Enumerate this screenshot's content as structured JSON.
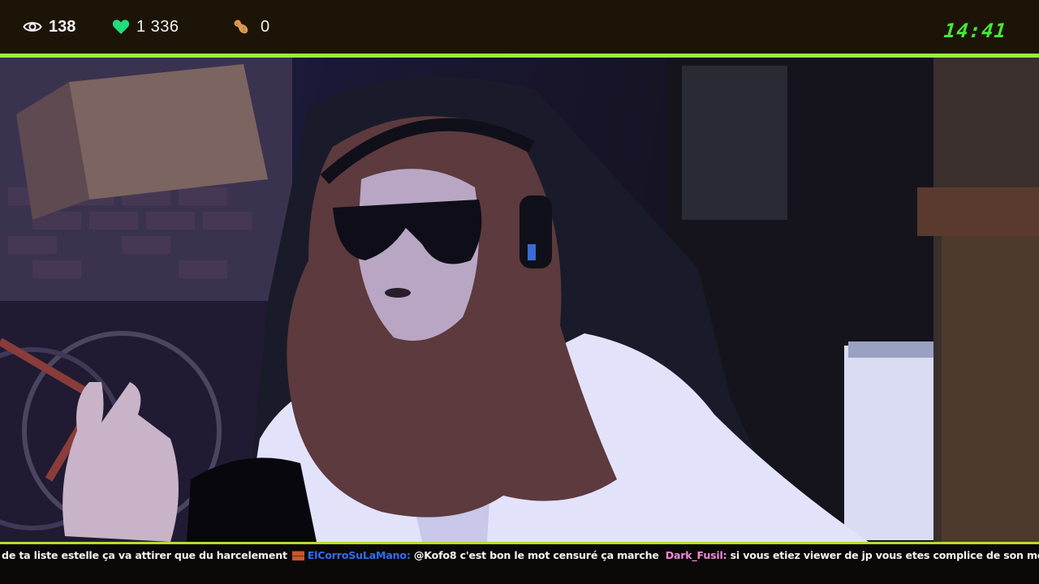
{
  "stats": {
    "viewers": {
      "icon": "eye-icon",
      "value": "138"
    },
    "likes": {
      "icon": "heart-icon",
      "value": "1 336",
      "color": "#22dd7a"
    },
    "peanuts": {
      "icon": "peanut-icon",
      "value": "0"
    }
  },
  "clock": {
    "time": "14:41",
    "color": "#44e83a"
  },
  "colors": {
    "top_bar": "#1d1408",
    "accent_line": "#9aef3a",
    "ticker_line": "#b8dc2e"
  },
  "ticker": {
    "msg1_text": "de ta liste estelle ça va attirer que du harcelement",
    "msg2_icon": "brick-icon",
    "msg2_user": "ElCorroSuLaMano:",
    "msg2_user_color": "#2f6ef7",
    "msg2_text": "@Kofo8 c'est bon le mot censuré ça marche",
    "msg3_user": "Dark_Fusil:",
    "msg3_user_color": "#f08ad8",
    "msg3_text": "si vous etiez viewer de jp vous etes complice de son meurtre"
  }
}
